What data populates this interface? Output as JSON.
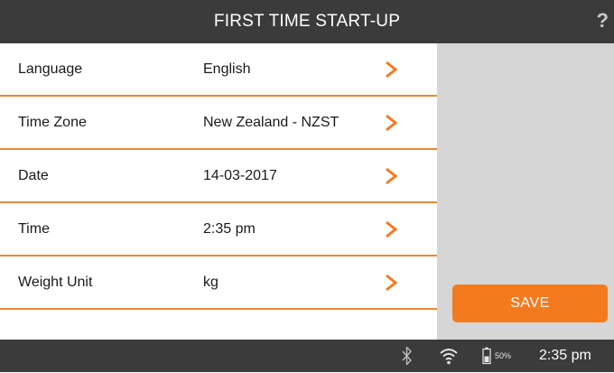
{
  "header": {
    "title": "FIRST TIME START-UP",
    "help": "?"
  },
  "settings": [
    {
      "label": "Language",
      "value": "English"
    },
    {
      "label": "Time Zone",
      "value": "New Zealand - NZST"
    },
    {
      "label": "Date",
      "value": "14-03-2017"
    },
    {
      "label": "Time",
      "value": "2:35 pm"
    },
    {
      "label": "Weight Unit",
      "value": "kg"
    }
  ],
  "actions": {
    "save_label": "SAVE"
  },
  "status": {
    "battery_percent": "50%",
    "battery_level": 0.5,
    "time": "2:35 pm",
    "icons": [
      "bluetooth-icon",
      "wifi-icon",
      "battery-icon"
    ]
  },
  "colors": {
    "accent": "#f47a20",
    "divider": "#e98a2b",
    "bars": "#3b3b3c",
    "side_panel": "#d6d6d6"
  }
}
